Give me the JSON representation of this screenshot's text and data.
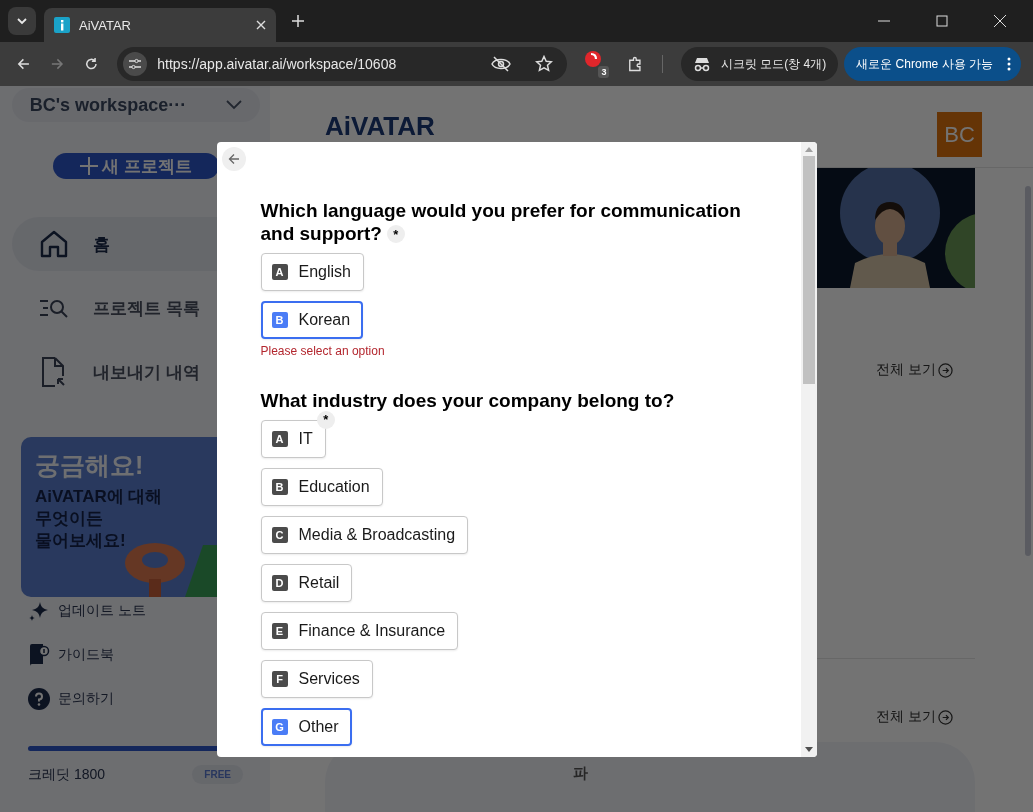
{
  "browser": {
    "tab": {
      "title": "AiVATAR"
    },
    "url": "https://app.aivatar.ai/workspace/10608",
    "extension_badge": "3",
    "incognito": "시크릿 모드(창 4개)",
    "update": "새로운 Chrome 사용 가능"
  },
  "sidebar": {
    "workspace": "BC's workspace···",
    "new_project": "새 프로젝트",
    "nav": [
      {
        "label": "홈",
        "kind": "home",
        "selected": true
      },
      {
        "label": "프로젝트 목록",
        "kind": "list",
        "selected": false
      },
      {
        "label": "내보내기 내역",
        "kind": "export",
        "selected": false
      }
    ],
    "banner": {
      "title": "궁금해요!",
      "text": "AiVATAR에 대해\n무엇이든\n물어보세요!"
    },
    "links": [
      {
        "label": "업데이트 노트",
        "kind": "sparkle"
      },
      {
        "label": "가이드북",
        "kind": "book"
      },
      {
        "label": "문의하기",
        "kind": "help"
      }
    ],
    "credit": {
      "label": "크레딧 1800",
      "level": 1,
      "plan": "FREE"
    }
  },
  "main": {
    "logo": "AiVATAR",
    "avatar": "BC",
    "view_all": [
      "전체 보기",
      "전체 보기"
    ],
    "card_text": "파"
  },
  "modal": {
    "questions": [
      {
        "text": "Which language would you prefer for communication and support?",
        "required_mark": "*",
        "error": "Please select an option",
        "options": [
          {
            "letter": "A",
            "label": "English",
            "selected": false
          },
          {
            "letter": "B",
            "label": "Korean",
            "selected": true
          }
        ]
      },
      {
        "text": "What industry does your company belong to?",
        "options": [
          {
            "letter": "A",
            "label": "IT",
            "selected": false,
            "required_mark": "*"
          },
          {
            "letter": "B",
            "label": "Education",
            "selected": false
          },
          {
            "letter": "C",
            "label": "Media & Broadcasting",
            "selected": false
          },
          {
            "letter": "D",
            "label": "Retail",
            "selected": false
          },
          {
            "letter": "E",
            "label": "Finance & Insurance",
            "selected": false
          },
          {
            "letter": "F",
            "label": "Services",
            "selected": false
          },
          {
            "letter": "G",
            "label": "Other",
            "selected": true
          }
        ]
      }
    ]
  }
}
